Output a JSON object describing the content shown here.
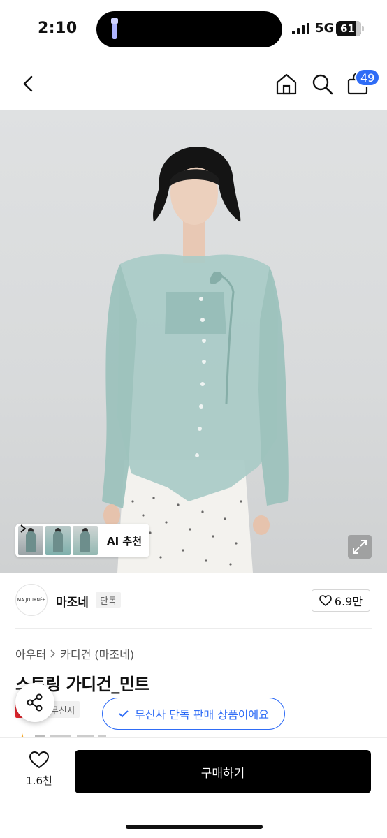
{
  "status": {
    "time": "2:10",
    "network": "5G",
    "battery": "61"
  },
  "nav": {
    "cart_count": "49"
  },
  "gallery": {
    "ai_label": "AI 추천"
  },
  "brand": {
    "logo_text": "MA JOURNÉE",
    "name": "마조네",
    "tag": "단독",
    "likes": "6.9만"
  },
  "product": {
    "breadcrumb": [
      "아우터",
      "카디건 (마조네)"
    ],
    "title": "스트링 가디건_민트",
    "tags": [
      "세일",
      "무신사"
    ],
    "tooltip": "무신사 단독 판매 상품이에요"
  },
  "bottom": {
    "wish_count": "1.6천",
    "buy_label": "구매하기"
  },
  "colors": {
    "accent": "#2f6cf6",
    "sale": "#e3272f",
    "cta": "#000000"
  }
}
